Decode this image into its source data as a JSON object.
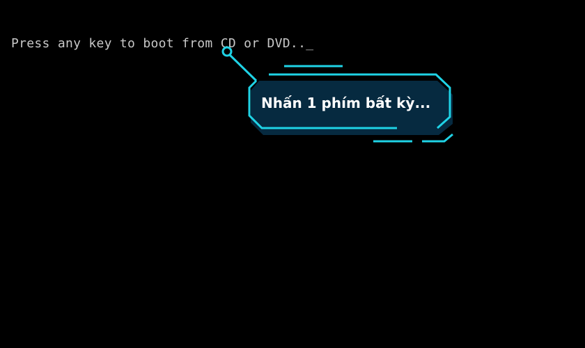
{
  "boot_screen": {
    "message": "Press any key to boot from CD or DVD..",
    "cursor": "_"
  },
  "callout": {
    "label": "Nhấn 1 phím bất kỳ...",
    "colors": {
      "accent": "#1fd3e6",
      "fill": "#062a40"
    }
  }
}
